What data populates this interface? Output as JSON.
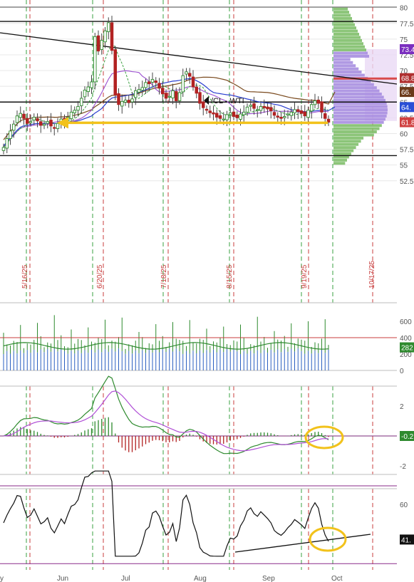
{
  "chart_data": [
    {
      "type": "candlestick",
      "annotation": "/CL - WTI",
      "ylim": [
        51.0,
        80.5
      ],
      "price_ticks": [
        "80",
        "77.5",
        "75",
        "72.5",
        "70",
        "67.5",
        "65",
        "62.5",
        "60",
        "57.5",
        "55",
        "52.5"
      ],
      "date_marks": [
        "5/16/25",
        "6/20/25",
        "7/18/25",
        "8/15/25",
        "9/19/25",
        "10/17/25"
      ],
      "price_tags": [
        {
          "label": "73.4",
          "value": 73.4,
          "color": "#7b2fbf"
        },
        {
          "label": "68.8",
          "value": 68.8,
          "color": "#b03030"
        },
        {
          "label": "66.",
          "value": 66.6,
          "color": "#6b3a1a"
        },
        {
          "label": "64.",
          "value": 64.2,
          "color": "#2a4fd6"
        },
        {
          "label": "61.8",
          "value": 61.8,
          "color": "#d04040"
        }
      ],
      "horizontal_levels": [
        77.8,
        65.0,
        56.5
      ],
      "support_line": 61.7,
      "closes": [
        57.8,
        59.2,
        60.4,
        61.5,
        62.8,
        63.2,
        62.4,
        61.6,
        61.9,
        62.6,
        62.0,
        61.3,
        61.5,
        61.9,
        61.2,
        60.9,
        61.6,
        62.3,
        61.8,
        62.6,
        63.4,
        63.7,
        64.3,
        65.6,
        66.9,
        67.4,
        68.2,
        75.4,
        73.1,
        74.8,
        76.3,
        77.6,
        73.2,
        66.1,
        64.6,
        65.1,
        65.3,
        64.9,
        65.5,
        66.8,
        67.0,
        67.3,
        68.1,
        67.9,
        68.6,
        68.1,
        67.2,
        66.3,
        65.6,
        65.9,
        66.8,
        65.2,
        66.5,
        69.2,
        69.8,
        69.1,
        67.4,
        66.4,
        64.8,
        64.1,
        63.7,
        63.3,
        63.1,
        62.6,
        62.4,
        62.3,
        63.0,
        63.3,
        62.7,
        62.5,
        63.1,
        63.4,
        64.2,
        64.5,
        64.0,
        63.8,
        64.3,
        64.1,
        63.9,
        63.6,
        62.9,
        62.6,
        62.4,
        62.7,
        63.1,
        63.4,
        63.8,
        63.5,
        63.2,
        62.8,
        63.7,
        64.6,
        65.2,
        64.8,
        63.4,
        62.4,
        61.8
      ],
      "volume_ticks": [
        "600",
        "400",
        "200",
        "0"
      ],
      "volume_value": "282",
      "macd_ticks": [
        "2",
        "-2"
      ],
      "macd_value": "-0.2",
      "rsi_ticks": [
        "60",
        "40"
      ],
      "rsi_value": "41.",
      "month_labels": [
        "y",
        "Jun",
        "Jul",
        "Aug",
        "Sep",
        "Oct"
      ]
    }
  ]
}
